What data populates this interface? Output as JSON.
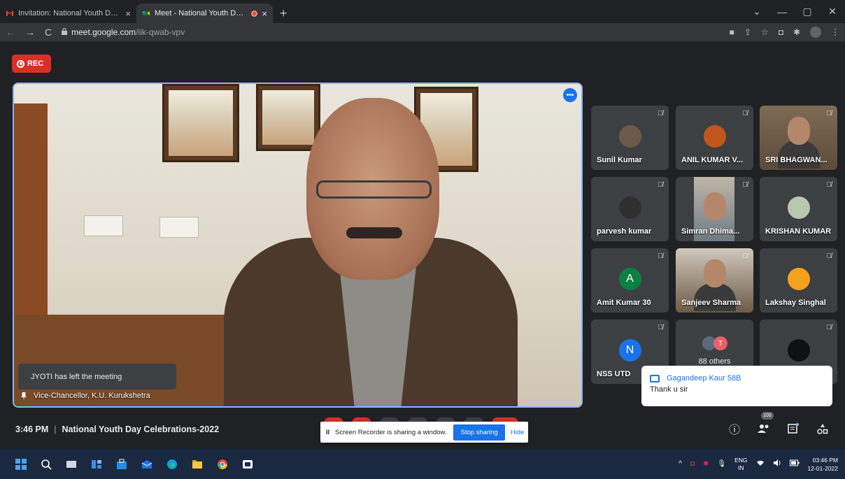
{
  "browser": {
    "tabs": [
      {
        "title": "Invitation: National Youth Day Ce",
        "favicon": "gmail-icon",
        "close": "×"
      },
      {
        "title": "Meet - National Youth Day C",
        "favicon": "meet-icon",
        "close": "×",
        "recording": true
      }
    ],
    "new_tab": "+",
    "window_controls": {
      "minimize": "—",
      "restore": "▢",
      "close": "✕",
      "tab_search": "⌄"
    },
    "url_host": "meet.google.com",
    "url_path": "/iik-qwab-vpv"
  },
  "meet": {
    "rec_label": "REC",
    "toast": "JYOTI has left the meeting",
    "speaker_label": "Vice-Chancellor, K.U. Kurukshetra",
    "more_options": "•••",
    "participants": [
      {
        "name": "Sunil Kumar",
        "muted": true,
        "kind": "avatar-photo"
      },
      {
        "name": "ANIL KUMAR V...",
        "muted": true,
        "kind": "avatar-photo"
      },
      {
        "name": "SRI BHAGWAN...",
        "muted": true,
        "kind": "video"
      },
      {
        "name": "parvesh kumar",
        "muted": true,
        "kind": "avatar-photo"
      },
      {
        "name": "Simran Dhima...",
        "muted": true,
        "kind": "video"
      },
      {
        "name": "KRISHAN KUMAR",
        "muted": true,
        "kind": "avatar-photo"
      },
      {
        "name": "Amit Kumar 30",
        "muted": true,
        "kind": "initial",
        "initial": "A",
        "color": "#0b8043"
      },
      {
        "name": "Sanjeev Sharma",
        "muted": true,
        "kind": "video"
      },
      {
        "name": "Lakshay Singhal",
        "muted": true,
        "kind": "avatar-photo"
      },
      {
        "name": "NSS UTD",
        "muted": true,
        "kind": "initial",
        "initial": "N",
        "color": "#1a73e8"
      },
      {
        "name": "",
        "others": "88 others",
        "mini_initial": "T"
      },
      {
        "name": "",
        "muted": true,
        "kind": "avatar-photo"
      }
    ],
    "chat": {
      "from": "Gagandeep Kaur 58B",
      "message": "Thank u sir"
    },
    "bottom": {
      "time": "3:46 PM",
      "separator": "|",
      "meeting_title": "National Youth Day Celebrations-2022",
      "share_status": "Screen Recorder is sharing a window.",
      "stop_sharing": "Stop sharing",
      "hide": "Hide",
      "participant_count": "100"
    }
  },
  "taskbar": {
    "lang_top": "ENG",
    "lang_bottom": "IN",
    "time": "03:46 PM",
    "date": "12-01-2022"
  }
}
